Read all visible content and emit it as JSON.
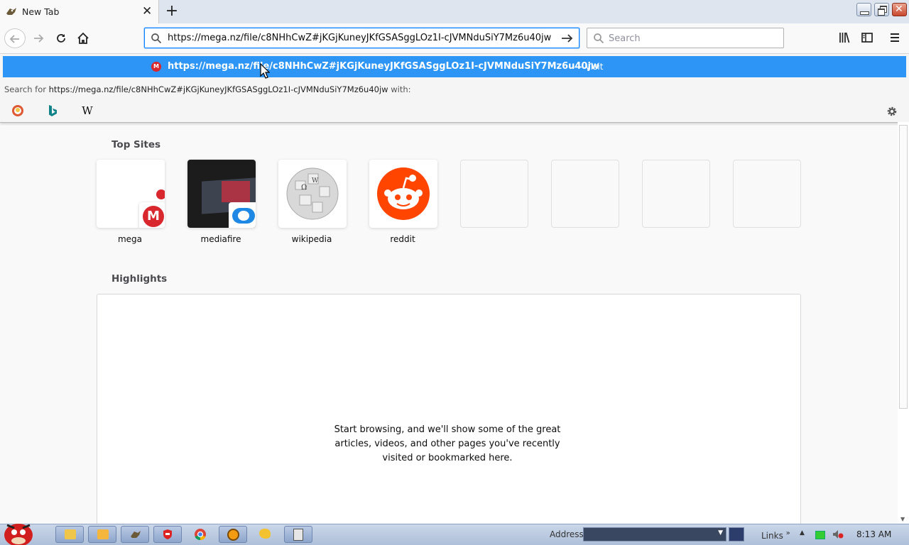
{
  "browser": {
    "tab": {
      "title": "New Tab",
      "icon": "angry-bird-icon"
    },
    "window_buttons": [
      "minimize",
      "restore",
      "close"
    ],
    "url_value": "https://mega.nz/file/c8NHhCwZ#jKGjKuneyJKfGSASggLOz1I-cJVMNduSiY7Mz6u40jw",
    "search_placeholder": "Search",
    "accent": "#0a84ff"
  },
  "dropdown": {
    "result_url": "https://mega.nz/file/c8NHhCwZ#jKGjKuneyJKfGSASggLOz1I-cJVMNduSiY7Mz6u40jw",
    "result_sep": "—",
    "result_action": "Visit",
    "search_for_prefix": "Search for",
    "search_for_query": "https://mega.nz/file/c8NHhCwZ#jKGjKuneyJKfGSASggLOz1I-cJVMNduSiY7Mz6u40jw",
    "search_for_suffix": "with:",
    "engines": [
      "duckduckgo-icon",
      "bing-icon",
      "wikipedia-icon"
    ],
    "highlight_color": "#2d95f5"
  },
  "newtab": {
    "top_sites_title": "Top Sites",
    "top_sites": [
      {
        "label": "mega",
        "icon": "mega-icon"
      },
      {
        "label": "mediafire",
        "icon": "mediafire-icon"
      },
      {
        "label": "wikipedia",
        "icon": "wikipedia-icon"
      },
      {
        "label": "reddit",
        "icon": "reddit-icon"
      }
    ],
    "highlights_title": "Highlights",
    "highlights_message": "Start browsing, and we'll show some of the great articles, videos, and other pages you've recently visited or bookmarked here."
  },
  "taskbar": {
    "address_label": "Address",
    "links_label": "Links",
    "links_chevron": "»",
    "clock": "8:13 AM"
  }
}
